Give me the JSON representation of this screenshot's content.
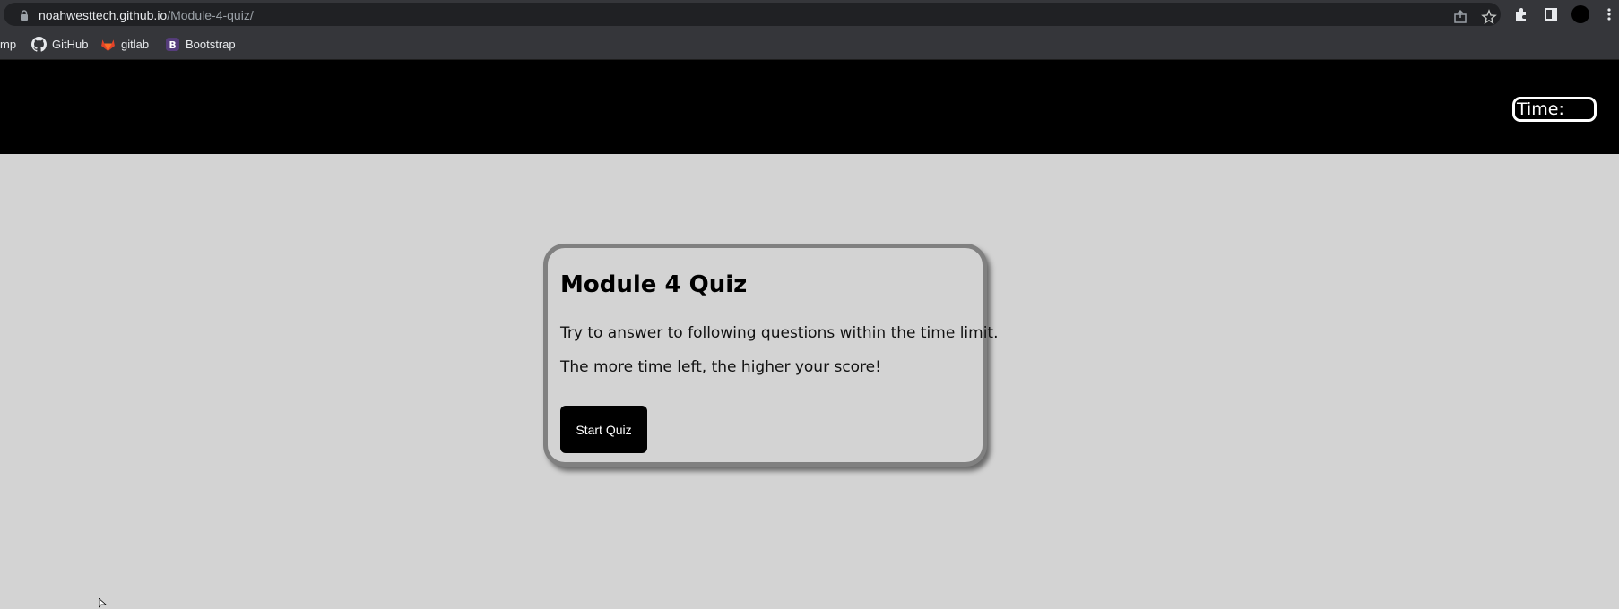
{
  "browser": {
    "url_host": "noahwesttech.github.io",
    "url_path": "/Module-4-quiz/",
    "bookmarks": [
      {
        "label": "mp",
        "icon": "bookmark-partial"
      },
      {
        "label": "GitHub",
        "icon": "github-icon"
      },
      {
        "label": "gitlab",
        "icon": "gitlab-icon"
      },
      {
        "label": "Bootstrap",
        "icon": "bootstrap-icon"
      }
    ]
  },
  "header": {
    "timer_label": "Time:",
    "timer_value": ""
  },
  "quiz": {
    "title": "Module 4 Quiz",
    "line1": "Try to answer to following questions within the time limit.",
    "line2": "The more time left, the higher your score!",
    "start_label": "Start Quiz"
  },
  "colors": {
    "page_bg": "#d3d3d3",
    "header_bg": "#000000",
    "card_border": "#808080",
    "button_bg": "#000000"
  }
}
